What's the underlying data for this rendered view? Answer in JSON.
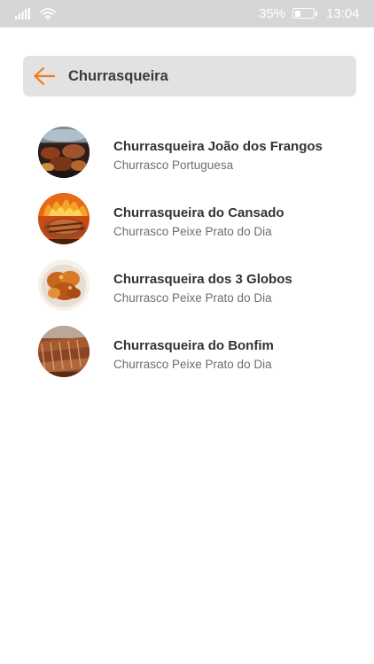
{
  "status_bar": {
    "signal_icon": "signal-bars-icon",
    "wifi_icon": "wifi-icon",
    "battery_percent": "35%",
    "battery_level": 0.35,
    "time": "13:04"
  },
  "search": {
    "back_icon": "arrow-left-icon",
    "query": "Churrasqueira"
  },
  "colors": {
    "accent": "#f07a1a",
    "status_bar_bg": "#d6d6d6",
    "search_bg": "#e2e2e2"
  },
  "results": [
    {
      "title": "Churrasqueira João dos Frangos",
      "subtitle": "Churrasco Portuguesa",
      "image": "grilled-meat-photo"
    },
    {
      "title": "Churrasqueira do Cansado",
      "subtitle": "Churrasco Peixe Prato do Dia",
      "image": "grilled-chicken-fire-photo"
    },
    {
      "title": "Churrasqueira dos 3 Globos",
      "subtitle": "Churrasco Peixe Prato do Dia",
      "image": "roast-chicken-photo"
    },
    {
      "title": "Churrasqueira do Bonfim",
      "subtitle": "Churrasco Peixe Prato do Dia",
      "image": "grilled-ribs-photo"
    }
  ]
}
